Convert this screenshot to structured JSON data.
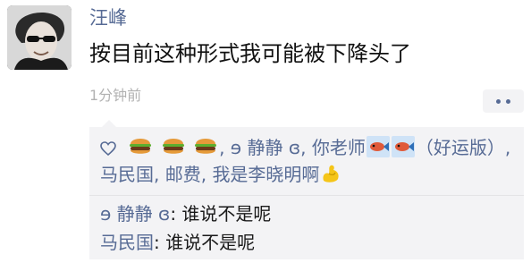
{
  "post": {
    "author": "汪峰",
    "text": "按目前这种形式我可能被下降头了",
    "timestamp": "1分钟前"
  },
  "likes": {
    "line1_prefix": ", ",
    "name1": "ɘ 静静 ɞ",
    "sep1": ", ",
    "name2": "你老师",
    "name2_suffix": "（好运版）",
    "sep2": ", ",
    "name3": "马民国",
    "sep3": ", ",
    "name4": "邮费",
    "sep4": ", ",
    "name5": "我是李晓明啊"
  },
  "comments": [
    {
      "author": "ɘ 静静 ɞ",
      "text": ": 谁说不是呢"
    },
    {
      "author": "马民国",
      "text": ": 谁说不是呢"
    }
  ],
  "colors": {
    "link": "#576b95",
    "comment_bg": "#f3f3f5",
    "muted": "#b2b2b2"
  },
  "icons": [
    "avatar-photo",
    "heart-outline-icon",
    "hamburger-emoji",
    "fish-emoji",
    "flexed-biceps-emoji",
    "more-dots-icon"
  ]
}
